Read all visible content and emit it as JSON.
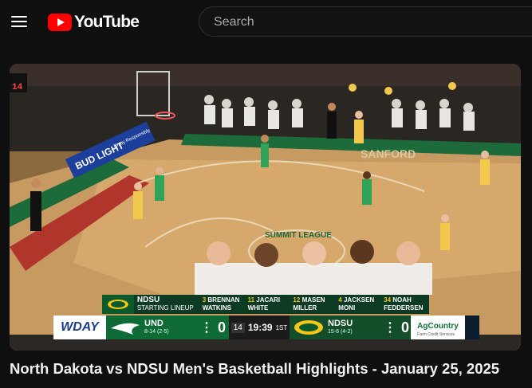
{
  "topbar": {
    "logo_text": "YouTube",
    "search_placeholder": "Search"
  },
  "video": {
    "title": "North Dakota vs NDSU Men's Basketball Highlights - January 25, 2025",
    "arena_signage": {
      "banner": "BUD LIGHT",
      "banner_sub": "Enjoy Responsibly",
      "court_text": "SANFORD",
      "center_logo": "SUMMIT LEAGUE",
      "shot_clock": "14"
    },
    "lineup": {
      "team": "NDSU",
      "subtitle": "STARTING LINEUP",
      "players": [
        {
          "num": "3",
          "first": "BRENNAN",
          "last": "WATKINS"
        },
        {
          "num": "11",
          "first": "JACARI",
          "last": "WHITE"
        },
        {
          "num": "12",
          "first": "MASEN",
          "last": "MILLER"
        },
        {
          "num": "4",
          "first": "JACKSEN",
          "last": "MONI"
        },
        {
          "num": "34",
          "first": "NOAH",
          "last": "FEDDERSEN"
        }
      ]
    },
    "scorebug": {
      "broadcaster": "WDAY",
      "home": {
        "name": "UND",
        "record": "8-14 (2-5)",
        "score": "0"
      },
      "away": {
        "name": "NDSU",
        "record": "15-6 (4-2)",
        "score": "0"
      },
      "shot_clock": "14",
      "game_clock": "19:39",
      "period": "1ST",
      "sponsor": "AgCountry",
      "sponsor_sub": "Farm Credit Services"
    }
  },
  "colors": {
    "youtube_red": "#ff0000",
    "background": "#0f0f0f",
    "ndsu_green": "#0e6b35",
    "ndsu_gold": "#f5c518"
  }
}
